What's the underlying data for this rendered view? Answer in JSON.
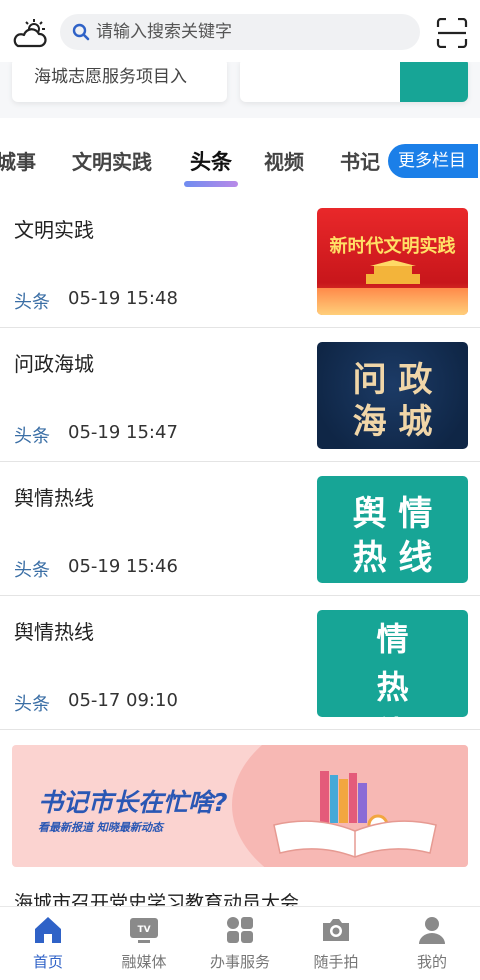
{
  "header": {
    "weather_icon": "cloud-sun-icon",
    "search_placeholder": "请输入搜索关键字",
    "scan_icon": "scan-icon"
  },
  "cards": {
    "first_label": "海城志愿服务项目入"
  },
  "tabs": {
    "items": [
      "城事",
      "文明实践",
      "头条",
      "视频",
      "书记"
    ],
    "active": "头条",
    "more_label": "更多栏目"
  },
  "news": [
    {
      "title": "文明实践",
      "tag": "头条",
      "time": "05-19 15:48",
      "thumb_text": "新时代文明实践"
    },
    {
      "title": "问政海城",
      "tag": "头条",
      "time": "05-19 15:47",
      "thumb_text_line1": "问 政",
      "thumb_text_line2": "海 城"
    },
    {
      "title": "舆情热线",
      "tag": "头条",
      "time": "05-19 15:46",
      "thumb_text_line1": "舆 情",
      "thumb_text_line2": "热 线"
    },
    {
      "title": "舆情热线",
      "tag": "头条",
      "time": "05-17 09:10",
      "thumb_text_line1": "情",
      "thumb_text_line2": "热",
      "thumb_text_line3": "线"
    }
  ],
  "banner": {
    "title": "书记市长在忙啥?",
    "subtitle": "看最新报道  知晓最新动态"
  },
  "next_article_title": "海城市召开党史学习教育动员大会",
  "bottom_nav": [
    {
      "label": "首页",
      "icon": "home-icon",
      "active": true
    },
    {
      "label": "融媒体",
      "icon": "tv-icon",
      "active": false
    },
    {
      "label": "办事服务",
      "icon": "grid-icon",
      "active": false
    },
    {
      "label": "随手拍",
      "icon": "camera-icon",
      "active": false
    },
    {
      "label": "我的",
      "icon": "user-icon",
      "active": false
    }
  ],
  "colors": {
    "primary": "#2f62c7",
    "more_button": "#1b7fe8",
    "tag_blue": "#3a6ea5",
    "teal": "#17a596",
    "navy": "#0f2646",
    "red": "#d81e22"
  }
}
